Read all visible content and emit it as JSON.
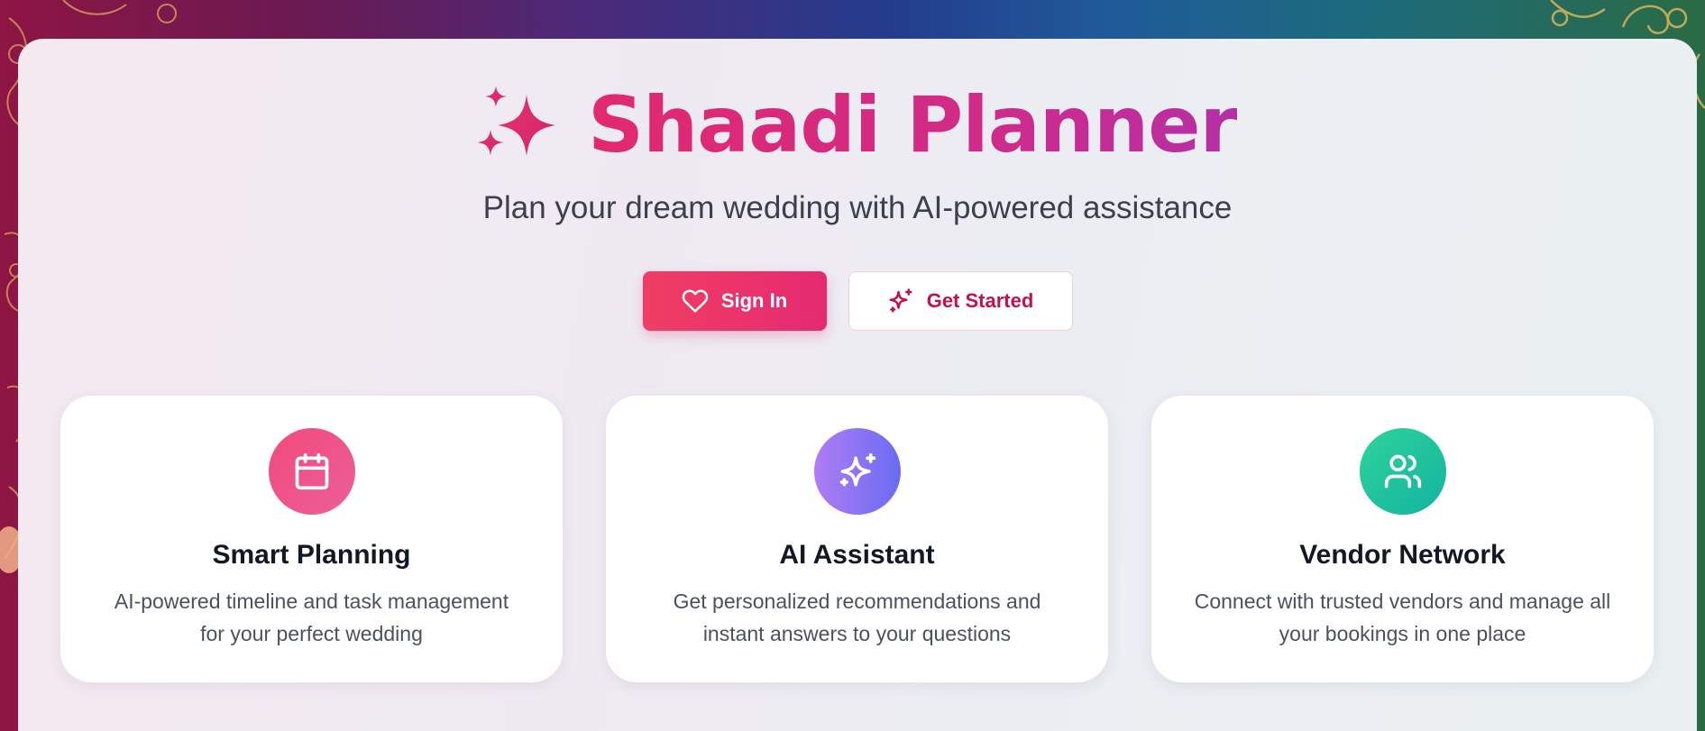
{
  "app": {
    "title": "Shaadi Planner",
    "subtitle": "Plan your dream wedding with AI-powered assistance",
    "title_icon": "sparkles-icon"
  },
  "actions": {
    "sign_in": {
      "label": "Sign In",
      "icon": "heart-icon"
    },
    "get_started": {
      "label": "Get Started",
      "icon": "sparkles-icon"
    }
  },
  "features": [
    {
      "title": "Smart Planning",
      "description_line1": "AI-powered timeline and task management",
      "description_line2": "for your perfect wedding",
      "icon": "calendar-icon"
    },
    {
      "title": "AI Assistant",
      "description_line1": "Get personalized recommendations and",
      "description_line2": "instant answers to your questions",
      "icon": "sparkles-icon"
    },
    {
      "title": "Vendor Network",
      "description_line1": "Connect with trusted vendors and manage all",
      "description_line2": "your bookings in one place",
      "icon": "users-icon"
    }
  ],
  "colors": {
    "brand_pink": "#e1296e",
    "button_primary": "#f03e63",
    "button_outline_text": "#c2124d",
    "feature_pink": "#f24a7a",
    "feature_purple": "#8a74f4",
    "feature_green": "#1fc49e"
  }
}
